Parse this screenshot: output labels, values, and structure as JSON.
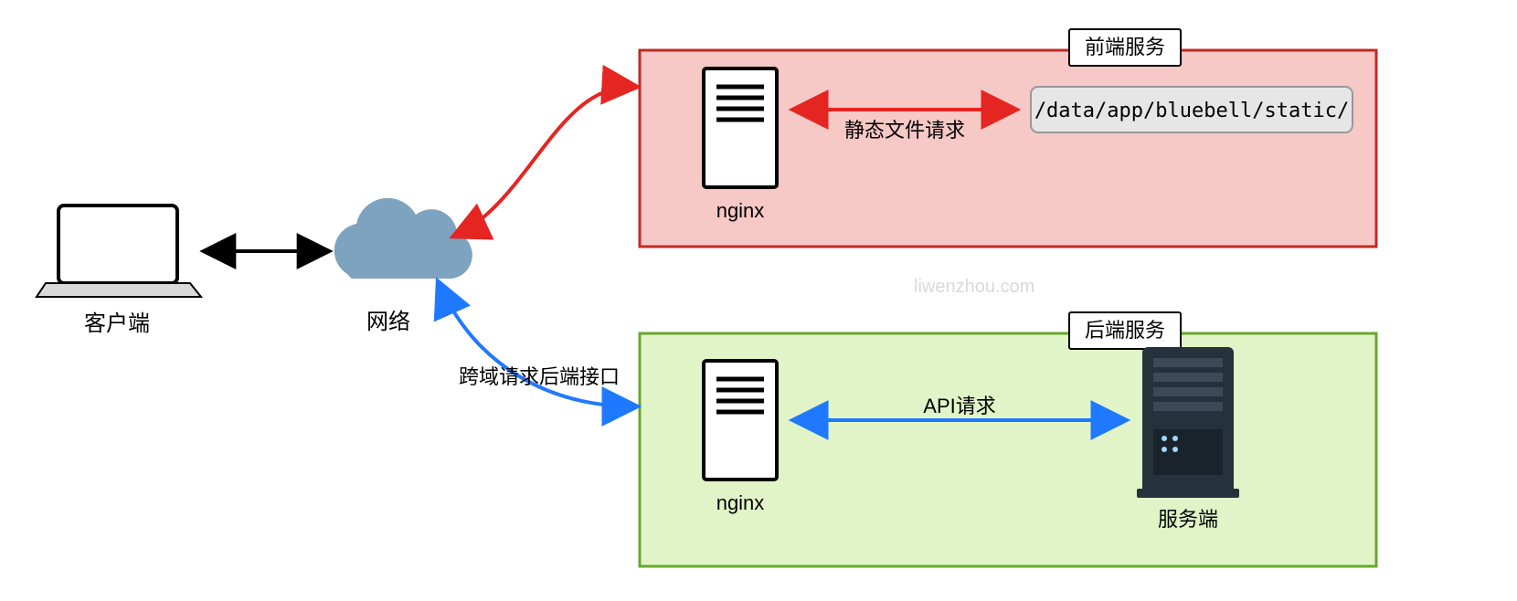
{
  "labels": {
    "client": "客户端",
    "network": "网络",
    "frontend_title": "前端服务",
    "backend_title": "后端服务",
    "nginx_front": "nginx",
    "nginx_back": "nginx",
    "server": "服务端",
    "static_path": "/data/app/bluebell/static/",
    "static_request": "静态文件请求",
    "api_request": "API请求",
    "cross_origin": "跨域请求后端接口",
    "watermark": "liwenzhou.com"
  },
  "colors": {
    "frontend_box_fill": "#f6c8c6",
    "frontend_box_stroke": "#c02a26",
    "backend_box_fill": "#e1f4c8",
    "backend_box_stroke": "#6aa52f",
    "arrow_black": "#000000",
    "arrow_red": "#e52521",
    "arrow_blue": "#1f79ff",
    "cloud_fill": "#7ea3bf",
    "path_box_fill": "#e6e6e6",
    "server_fill": "#25313c"
  }
}
